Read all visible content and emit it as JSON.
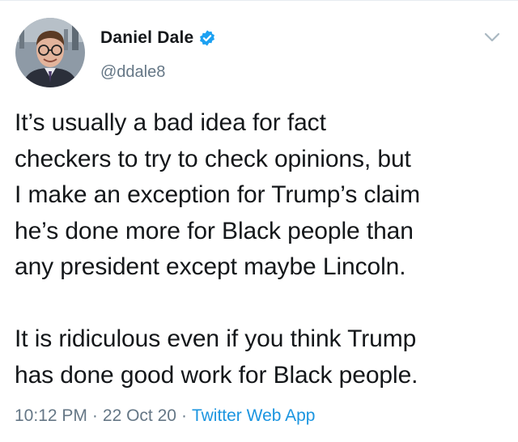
{
  "tweet": {
    "author": {
      "display_name": "Daniel Dale",
      "handle": "@ddale8",
      "verified": true
    },
    "paragraphs": [
      [
        "It’s usually a bad idea for fact",
        "checkers to try to check opinions, but",
        "I make an exception for Trump’s claim",
        "he’s done more for Black people than",
        "any president except maybe Lincoln."
      ],
      [
        "It is ridiculous even if you think Trump",
        "has done good work for Black people."
      ]
    ],
    "time": "10:12 PM",
    "separator": "·",
    "date": "22 Oct 20",
    "source": "Twitter Web App"
  },
  "colors": {
    "text": "#14171a",
    "secondary": "#657786",
    "accent": "#1b95e0",
    "verified_badge": "#1da1f2"
  },
  "icons": {
    "verified": "verified-badge-icon",
    "caret": "chevron-down-icon"
  }
}
